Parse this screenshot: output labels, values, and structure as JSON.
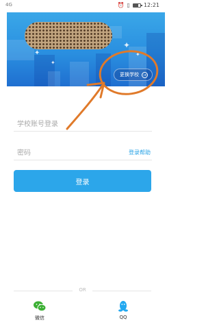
{
  "status_bar": {
    "left": "4G",
    "time": "12:21",
    "icons": [
      "alarm-icon",
      "vibrate-icon",
      "battery-icon"
    ]
  },
  "banner": {
    "change_school_label": "更换学校",
    "colors": {
      "top": "#3aa7e8",
      "bottom": "#1f6fd0"
    }
  },
  "form": {
    "account_placeholder": "学校账号登录",
    "password_label": "密码",
    "help_link": "登录帮助",
    "login_button": "登录",
    "accent": "#2ca6ea"
  },
  "footer": {
    "divider_text": "OR",
    "social": [
      {
        "label": "微信",
        "icon": "wechat-icon",
        "color": "#3cb034"
      },
      {
        "label": "QQ",
        "icon": "qq-icon",
        "color": "#22a8f0"
      }
    ]
  },
  "annotation": {
    "color": "#e07a2a"
  }
}
